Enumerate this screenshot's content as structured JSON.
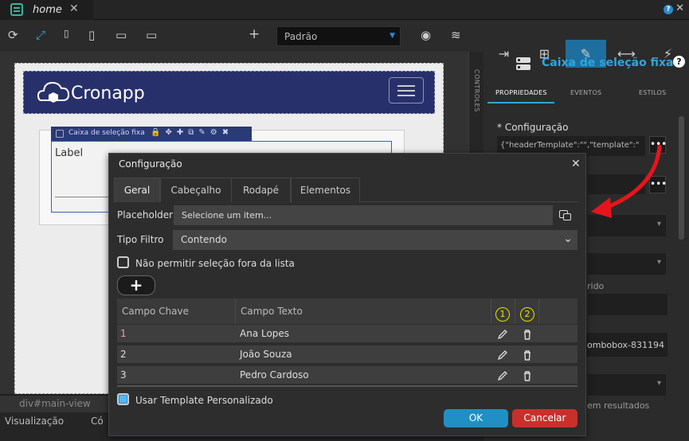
{
  "tab": {
    "title": "home",
    "close": "✕"
  },
  "window": {
    "help": "?",
    "close": "✕"
  },
  "toolbar": {
    "preset": "Padrão"
  },
  "canvas": {
    "logo_text": "Cronapp",
    "component_header": "Caixa de seleção fixa",
    "component_label": "Label",
    "controls_label": "CONTROLES"
  },
  "breadcrumb": "div#main-view",
  "bottom_tabs": {
    "visual": "Visualização",
    "code": "Có"
  },
  "right_panel": {
    "title": "Caixa de seleção fixa",
    "help": "?",
    "subtabs": [
      "PROPRIEDADES",
      "EVENTOS",
      "ESTILOS"
    ],
    "config_label": "* Configuração",
    "config_value": "{\"headerTemplate\":\"\",\"template\":\"",
    "config_btn": "•••",
    "partial_texts": [
      "rido",
      "ombobox-831194",
      "em resultados"
    ]
  },
  "dialog": {
    "title": "Configuração",
    "close": "✕",
    "tabs": [
      "Geral",
      "Cabeçalho",
      "Rodapé",
      "Elementos"
    ],
    "placeholder_label": "Placeholder",
    "placeholder_value": "Selecione um item...",
    "filter_label": "Tipo Filtro",
    "filter_value": "Contendo",
    "not_allow_label": "Não permitir seleção fora da lista",
    "add_button": "+",
    "grid": {
      "headers": [
        "Campo Chave",
        "Campo Texto"
      ],
      "action_numbers": [
        "1",
        "2"
      ],
      "rows": [
        {
          "key": "1",
          "text": "Ana Lopes"
        },
        {
          "key": "2",
          "text": "João Souza"
        },
        {
          "key": "3",
          "text": "Pedro Cardoso"
        }
      ]
    },
    "custom_template_label": "Usar Template Personalizado",
    "custom_template_checked": true,
    "ok": "OK",
    "cancel": "Cancelar"
  },
  "colors": {
    "accent": "#2fa6e0",
    "ok": "#1f8fc4",
    "cancel": "#c9302c",
    "arrow": "#e8141b",
    "highlight": "#e6e600"
  }
}
